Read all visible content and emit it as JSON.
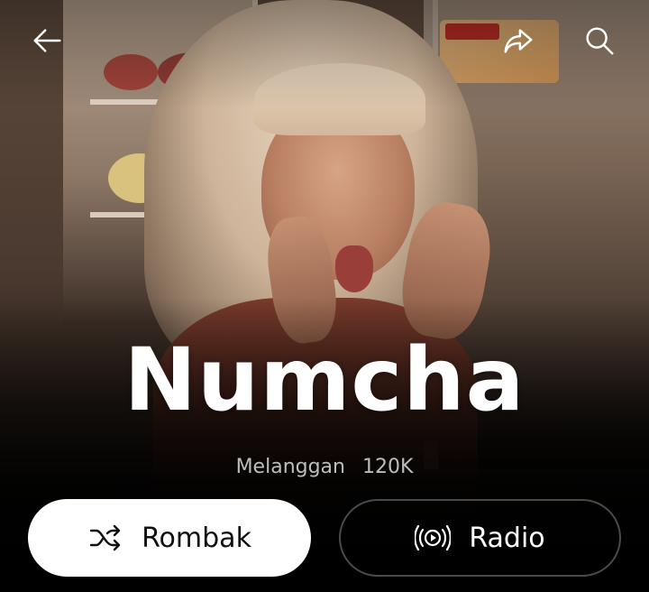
{
  "header": {
    "back_icon": "arrow-left-icon",
    "share_icon": "share-arrow-icon",
    "search_icon": "search-icon"
  },
  "artist": {
    "name": "Numcha",
    "subscribers_label": "Melanggan",
    "subscribers_count": "120K"
  },
  "actions": {
    "shuffle": {
      "label": "Rombak",
      "icon": "shuffle-icon"
    },
    "radio": {
      "label": "Radio",
      "icon": "radio-broadcast-icon"
    }
  },
  "colors": {
    "background": "#000000",
    "primary_button_bg": "#ffffff",
    "primary_button_text": "#111111",
    "secondary_button_border": "#4a4a4a",
    "subtitle": "#bdbdbd"
  }
}
